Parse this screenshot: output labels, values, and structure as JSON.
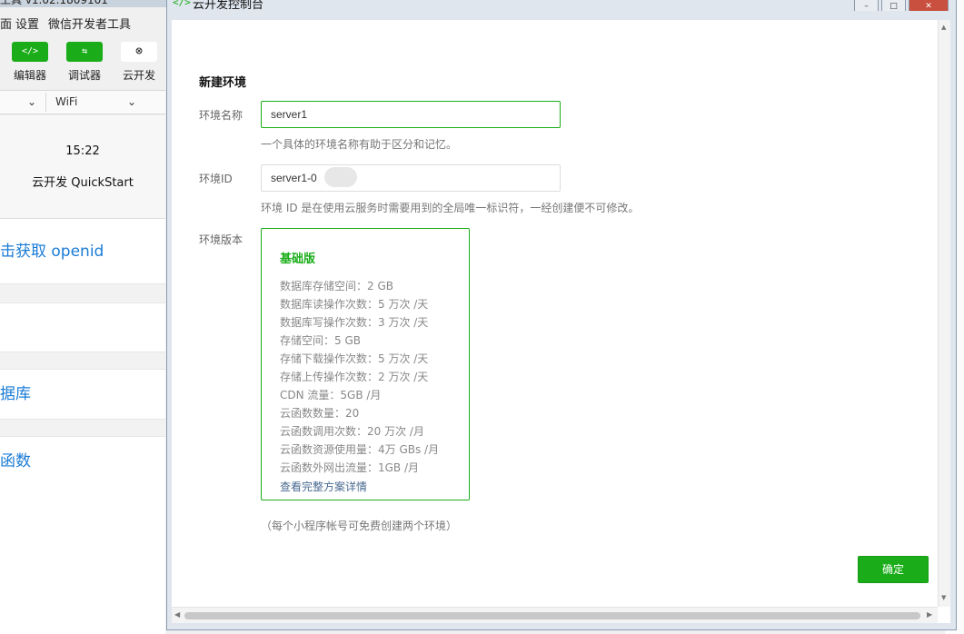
{
  "background_app": {
    "title_fragment": "工具 v1.02.1809101",
    "menu": [
      "面",
      "设置",
      "微信开发者工具"
    ],
    "toolbar": [
      {
        "label": "编辑器",
        "icon": "code-icon",
        "glyph": "</>"
      },
      {
        "label": "调试器",
        "icon": "debugger-icon",
        "glyph": "⇆"
      },
      {
        "label": "云开发",
        "icon": "cloud-link-icon",
        "glyph": "🔗"
      }
    ],
    "device_selector": {
      "network": "WiFi"
    },
    "simulator": {
      "time": "15:22",
      "nav_title": "云开发 QuickStart",
      "rows": [
        "击获取 openid",
        "据库",
        "函数"
      ]
    }
  },
  "dialog": {
    "window_title": "云开发控制台",
    "title_icon": "</>",
    "form": {
      "title": "新建环境",
      "name_label": "环境名称",
      "name_value": "server1",
      "name_hint": "一个具体的环境名称有助于区分和记忆。",
      "id_label": "环境ID",
      "id_value": "server1-0",
      "id_hint": "环境 ID 是在使用云服务时需要用到的全局唯一标识符，一经创建便不可修改。",
      "version_label": "环境版本"
    },
    "plan": {
      "name": "基础版",
      "features": [
        "数据库存储空间：2 GB",
        "数据库读操作次数：5 万次 /天",
        "数据库写操作次数：3 万次 /天",
        "存储空间：5 GB",
        "存储下载操作次数：5 万次 /天",
        "存储上传操作次数：2 万次 /天",
        "CDN 流量：5GB /月",
        "云函数数量：20",
        "云函数调用次数：20 万次 /月",
        "云函数资源使用量：4万 GBs /月",
        "云函数外网出流量：1GB /月"
      ],
      "details_link": "查看完整方案详情"
    },
    "note": "（每个小程序帐号可免费创建两个环境）",
    "confirm_label": "确定"
  },
  "colors": {
    "accent": "#1aad19",
    "link": "#1a7bd6"
  }
}
